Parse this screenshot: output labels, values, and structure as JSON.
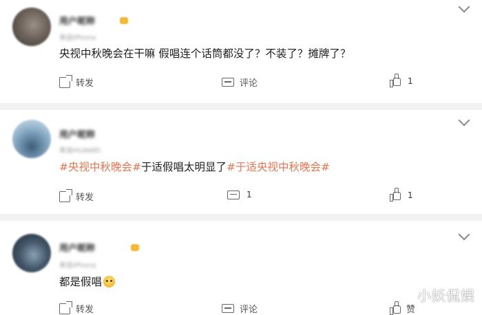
{
  "posts": [
    {
      "username_blurred": "用户昵称",
      "meta_blurred": "来自iPhone",
      "text": "央视中秋晚会在干嘛 假唱连个话筒都没了？不装了？摊牌了？",
      "forward_label": "转发",
      "comment_label": "评论",
      "comment_count": "",
      "like_label": "",
      "like_count": "1",
      "avatar": "blurred-avatar"
    },
    {
      "username_blurred": "用户昵称",
      "meta_blurred": "来自HUAWEI",
      "text_parts": [
        "#央视中秋晚会#",
        "于适假唱太明显了",
        "#于适央视中秋晚会#"
      ],
      "forward_label": "转发",
      "comment_label": "",
      "comment_count": "1",
      "like_label": "",
      "like_count": "1",
      "avatar": "blurred-avatar"
    },
    {
      "username_blurred": "用户昵称",
      "meta_blurred": "来自iPhone",
      "text": "都是假唱",
      "emoji": "crying-face-emoji",
      "forward_label": "转发",
      "comment_label": "评论",
      "comment_count": "",
      "like_label": "赞",
      "like_count": "",
      "avatar": "blurred-avatar"
    }
  ],
  "watermark": "小妖侃娱",
  "icons": [
    "chevron-down-icon",
    "forward-icon",
    "comment-icon",
    "like-icon",
    "vip-crown-icon"
  ],
  "colors": {
    "hashtag": "#eb7350",
    "separator": "#f2f2f2",
    "crown": "#f6b733"
  }
}
